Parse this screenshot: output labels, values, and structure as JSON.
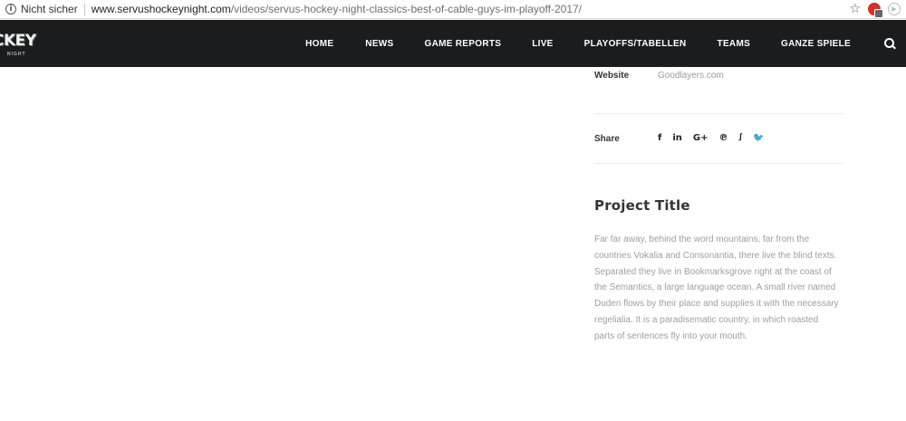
{
  "browser": {
    "secure_label": "Nicht sicher",
    "url_domain": "www.servushockeynight.com",
    "url_path": "/videos/servus-hockey-night-classics-best-of-cable-guys-im-playoff-2017/",
    "info_icon": "i",
    "bookmark_icon": "☆",
    "extension_badge": "ext",
    "play_icon": "▶"
  },
  "navbar": {
    "logo_text": "CKEY",
    "logo_sub": "NIGHT",
    "items": [
      {
        "label": "HOME"
      },
      {
        "label": "NEWS"
      },
      {
        "label": "GAME REPORTS"
      },
      {
        "label": "LIVE"
      },
      {
        "label": "PLAYOFFS/TABELLEN"
      },
      {
        "label": "TEAMS"
      },
      {
        "label": "GANZE SPIELE"
      }
    ]
  },
  "sidebar": {
    "website_label": "Website",
    "website_value": "Goodlayers.com",
    "share_label": "Share",
    "share_icons": [
      "f",
      "in",
      "G+",
      "℗",
      "ꭍ",
      "🐦"
    ],
    "share_icon_names": [
      "facebook",
      "linkedin",
      "google-plus",
      "pinterest",
      "stumbleupon",
      "twitter"
    ],
    "project_title": "Project Title",
    "project_text": "Far far away, behind the word mountains, far from the countries Vokalia and Consonantia, there live the blind texts. Separated they live in Bookmarksgrove right at the coast of the Semantics, a large language ocean. A small river named Duden flows by their place and supplies it with the necessary regelialia. It is a paradisematic country, in which roasted parts of sentences fly into your mouth."
  },
  "colors": {
    "navbar_bg": "#1b1c1e",
    "nav_text": "#ffffff",
    "body_text_muted": "#9e9e9e",
    "heading": "#333333"
  }
}
